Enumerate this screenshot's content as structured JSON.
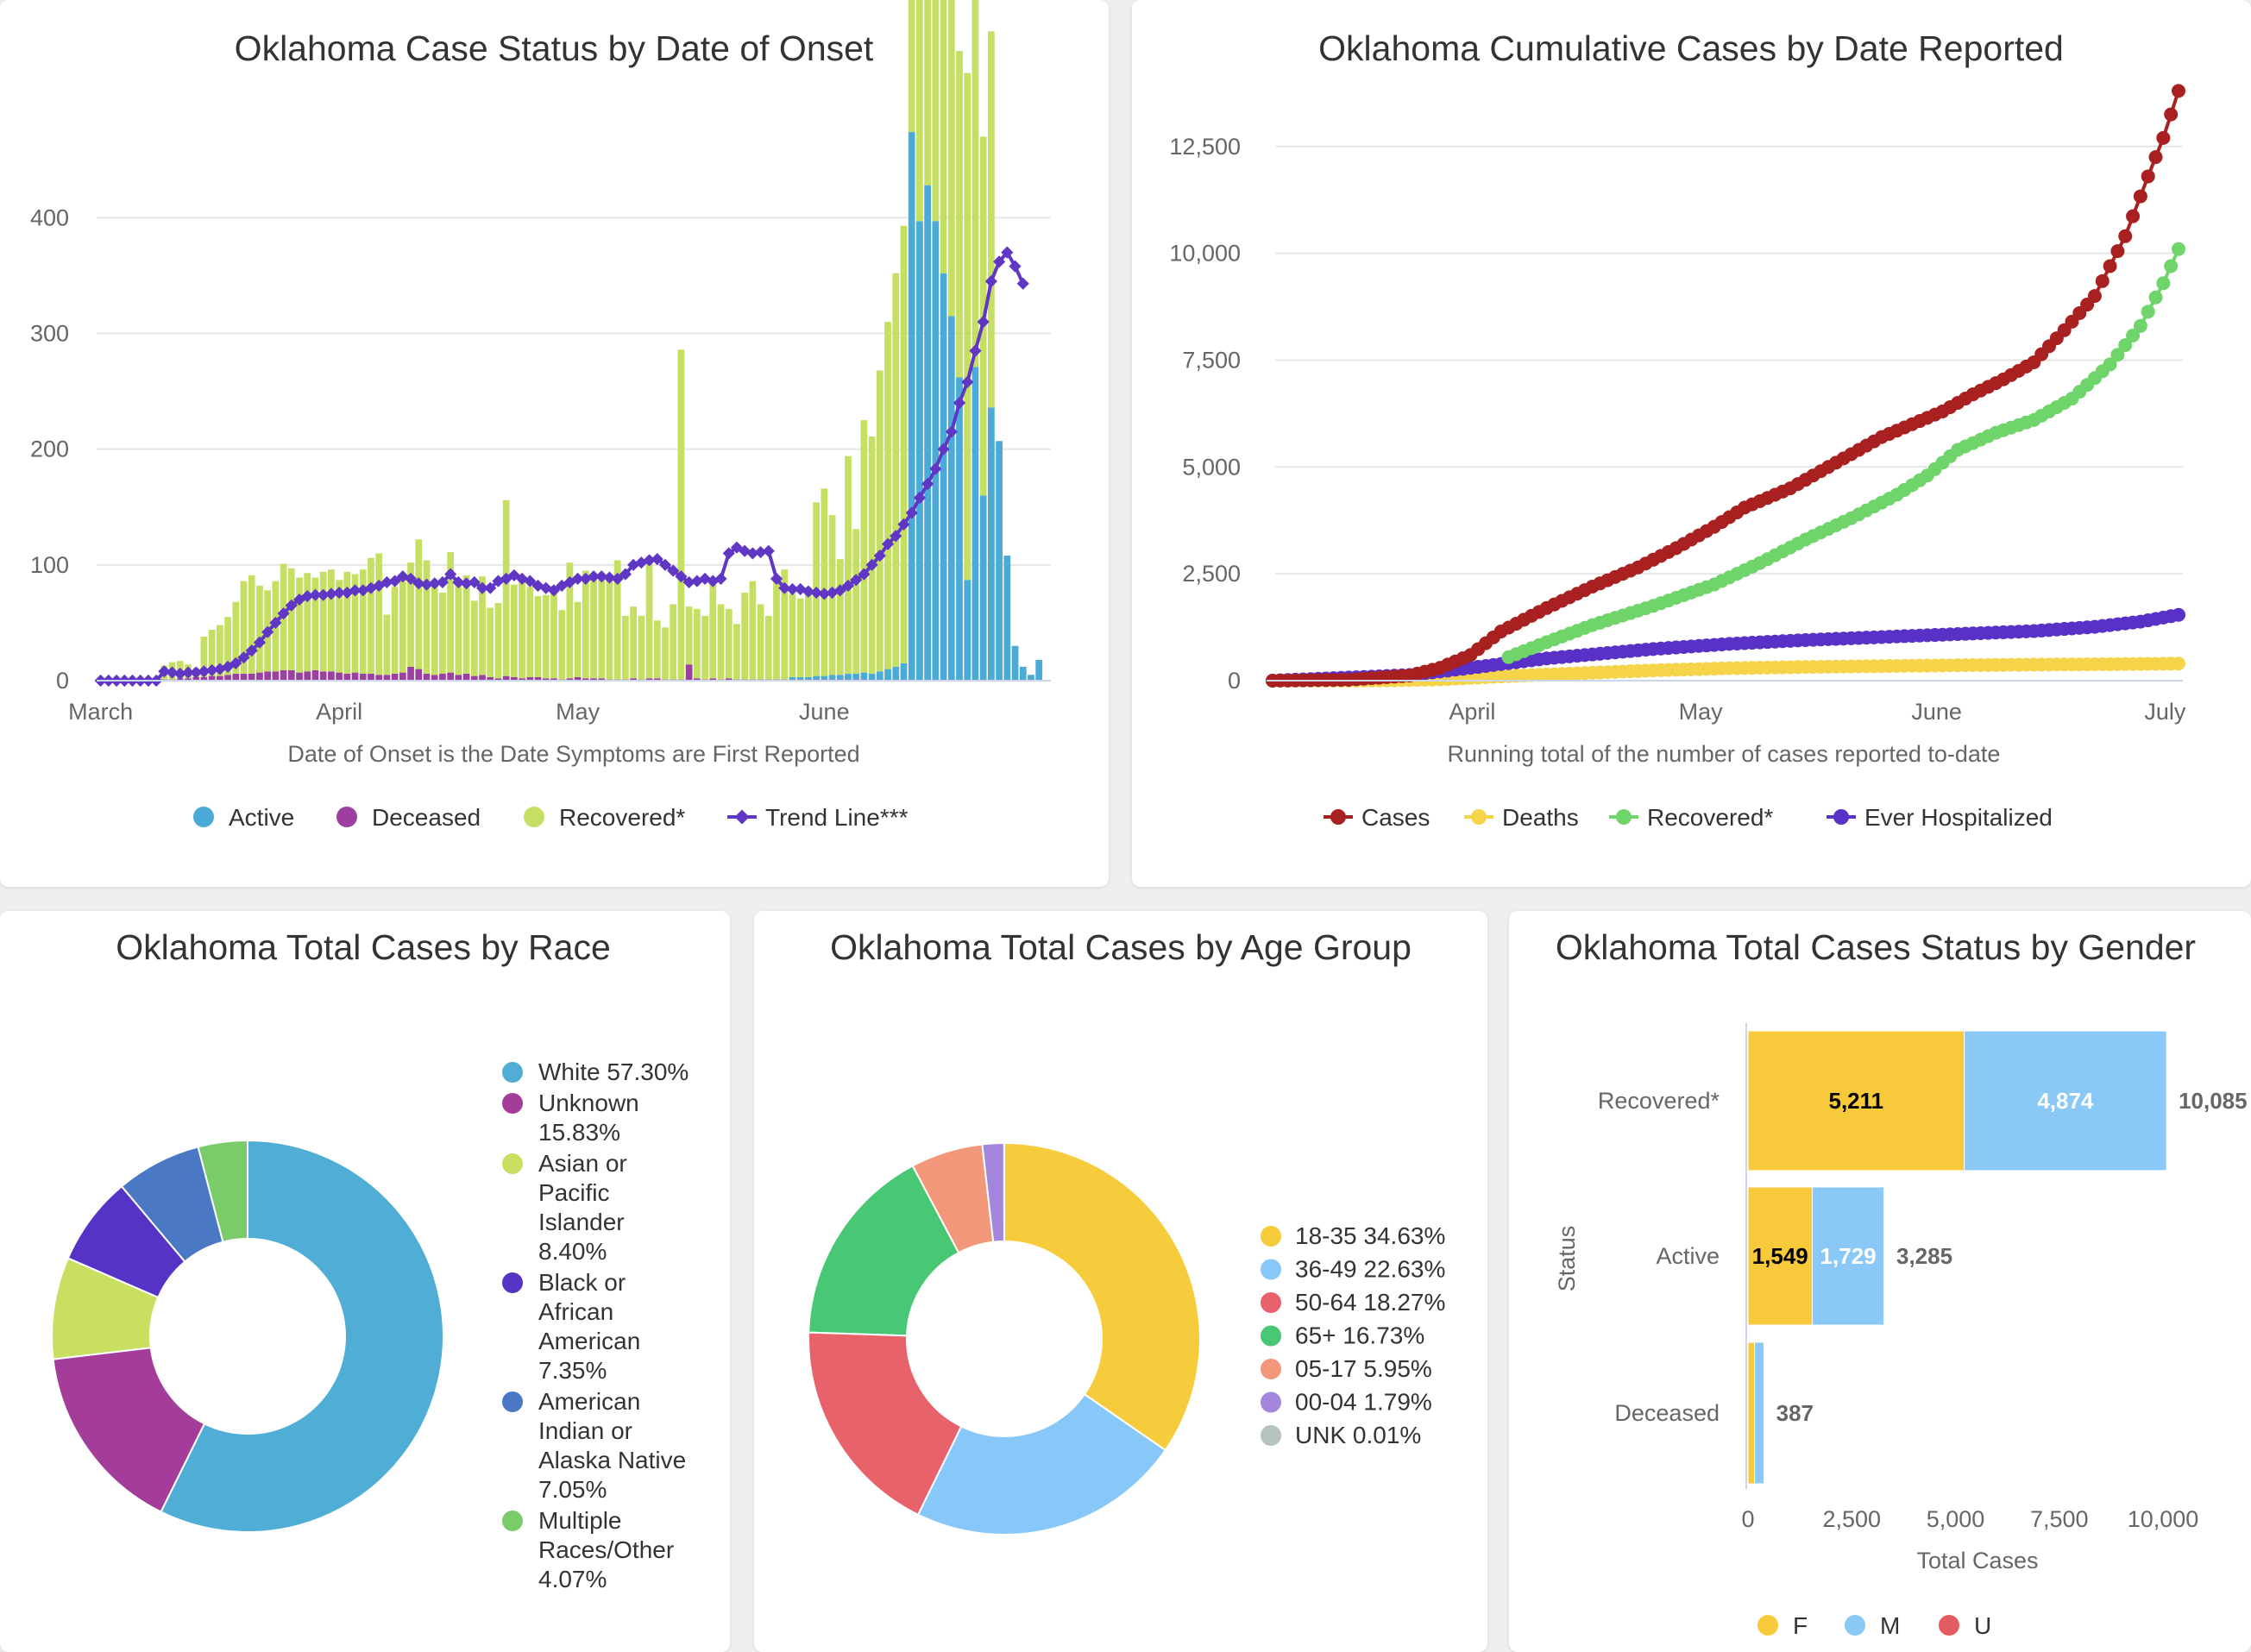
{
  "colors": {
    "active": "#4aabd8",
    "deceased": "#9c3fa0",
    "recovered": "#c5df63",
    "trend": "#6036c4",
    "cases": "#a82020",
    "deaths": "#f5d44a",
    "recovered2": "#6fd46a",
    "hospitalized": "#5a31c6",
    "gender_f": "#f8c93a",
    "gender_m": "#8ac8f7",
    "gender_u": "#e25c62"
  },
  "chart_data": [
    {
      "type": "bar",
      "title": "Oklahoma Case Status by Date of Onset",
      "xlabel": "Date of Onset is the Date Symptoms are First Reported",
      "ylabel": "",
      "ylim": [
        0,
        480
      ],
      "yticks": [
        0,
        100,
        200,
        300,
        400
      ],
      "xticks": [
        {
          "label": "March",
          "day": 0
        },
        {
          "label": "April",
          "day": 30
        },
        {
          "label": "May",
          "day": 60
        },
        {
          "label": "June",
          "day": 91
        }
      ],
      "legend_position": "bottom",
      "stacked": true,
      "categories_note": "days since first bar",
      "series": [
        {
          "name": "Active",
          "color_key": "active",
          "values": [
            0,
            0,
            0,
            0,
            0,
            0,
            0,
            0,
            0,
            0,
            0,
            0,
            0,
            0,
            0,
            0,
            0,
            0,
            0,
            0,
            0,
            0,
            0,
            0,
            0,
            0,
            0,
            0,
            0,
            0,
            0,
            0,
            0,
            0,
            0,
            0,
            0,
            0,
            0,
            0,
            0,
            0,
            0,
            0,
            0,
            0,
            0,
            0,
            0,
            0,
            0,
            0,
            0,
            0,
            0,
            0,
            0,
            0,
            0,
            0,
            0,
            0,
            0,
            0,
            0,
            0,
            0,
            0,
            0,
            0,
            0,
            0,
            0,
            0,
            0,
            0,
            0,
            0,
            0,
            0,
            0,
            0,
            0,
            0,
            0,
            0,
            0,
            2,
            2,
            2,
            3,
            3,
            4,
            4,
            5,
            5,
            6,
            6,
            8,
            10,
            12,
            15,
            474,
            397,
            428,
            397,
            352,
            315,
            262,
            87,
            271,
            160,
            236,
            207,
            108,
            30,
            12,
            5,
            18
          ]
        },
        {
          "name": "Deceased",
          "color_key": "deceased",
          "values": [
            0,
            0,
            0,
            0,
            0,
            0,
            0,
            0,
            1,
            1,
            2,
            2,
            3,
            3,
            4,
            4,
            5,
            6,
            6,
            6,
            7,
            8,
            8,
            9,
            9,
            7,
            8,
            9,
            8,
            8,
            7,
            6,
            7,
            6,
            6,
            5,
            5,
            6,
            7,
            12,
            10,
            6,
            5,
            6,
            7,
            5,
            6,
            4,
            5,
            3,
            2,
            4,
            3,
            2,
            3,
            3,
            2,
            2,
            1,
            2,
            3,
            2,
            2,
            2,
            1,
            1,
            1,
            2,
            1,
            2,
            2,
            1,
            1,
            1,
            14,
            2,
            1,
            2,
            1,
            2,
            1,
            1,
            1,
            1,
            1,
            1,
            1,
            1,
            1,
            1,
            1,
            1,
            1,
            1,
            1,
            1,
            1,
            0,
            0,
            0,
            0,
            0,
            0,
            0,
            0,
            0,
            0,
            0,
            0,
            0,
            0,
            0,
            0,
            0,
            0,
            0,
            0
          ]
        },
        {
          "name": "Recovered*",
          "color_key": "recovered",
          "values": [
            0,
            0,
            0,
            0,
            0,
            0,
            0,
            0,
            12,
            15,
            15,
            12,
            8,
            35,
            40,
            44,
            50,
            62,
            80,
            85,
            75,
            70,
            78,
            92,
            88,
            82,
            85,
            80,
            86,
            88,
            80,
            88,
            85,
            90,
            100,
            105,
            52,
            75,
            80,
            90,
            112,
            98,
            82,
            70,
            104,
            80,
            85,
            65,
            85,
            60,
            65,
            152,
            80,
            88,
            78,
            70,
            72,
            80,
            60,
            100,
            65,
            93,
            85,
            88,
            90,
            103,
            55,
            62,
            55,
            105,
            50,
            45,
            65,
            285,
            50,
            60,
            55,
            82,
            65,
            60,
            48,
            75,
            85,
            65,
            55,
            88,
            95,
            72,
            68,
            78,
            150,
            162,
            138,
            100,
            188,
            125,
            218,
            205,
            260,
            300,
            340,
            378,
            310,
            330,
            350,
            250,
            270,
            352,
            282,
            438,
            382,
            310,
            325,
            0,
            0,
            0,
            0
          ]
        },
        {
          "name": "Trend Line***",
          "color_key": "trend",
          "type": "line",
          "values": [
            0,
            0,
            0,
            0,
            0,
            0,
            0,
            0,
            8,
            7,
            6,
            7,
            7,
            8,
            9,
            10,
            12,
            15,
            20,
            26,
            33,
            42,
            50,
            58,
            65,
            70,
            73,
            74,
            74,
            75,
            76,
            76,
            78,
            78,
            80,
            82,
            85,
            86,
            90,
            88,
            84,
            83,
            84,
            85,
            92,
            85,
            84,
            85,
            80,
            80,
            86,
            88,
            91,
            88,
            86,
            82,
            80,
            78,
            82,
            85,
            88,
            88,
            90,
            90,
            89,
            88,
            92,
            100,
            102,
            104,
            105,
            100,
            95,
            90,
            85,
            86,
            88,
            86,
            88,
            110,
            115,
            112,
            110,
            111,
            112,
            88,
            80,
            79,
            79,
            77,
            76,
            75,
            76,
            78,
            82,
            87,
            92,
            100,
            108,
            118,
            125,
            135,
            145,
            158,
            170,
            183,
            200,
            215,
            240,
            258,
            285,
            310,
            345,
            362,
            370,
            358,
            343
          ]
        }
      ]
    },
    {
      "type": "line",
      "title": "Oklahoma Cumulative Cases by Date Reported",
      "xlabel": "Running total of the number of cases reported to-date",
      "ylabel": "",
      "ylim": [
        0,
        13000
      ],
      "yticks": [
        0,
        2500,
        5000,
        7500,
        10000,
        12500
      ],
      "ytick_labels": [
        "0",
        "2,500",
        "5,000",
        "7,500",
        "10,000",
        "12,500"
      ],
      "xticks": [
        {
          "label": "April",
          "day": 26
        },
        {
          "label": "May",
          "day": 56
        },
        {
          "label": "June",
          "day": 87
        },
        {
          "label": "July",
          "day": 117
        }
      ],
      "legend_position": "bottom",
      "series": [
        {
          "name": "Cases",
          "color_key": "cases",
          "points": [
            [
              0,
              0
            ],
            [
              10,
              20
            ],
            [
              18,
              120
            ],
            [
              22,
              300
            ],
            [
              26,
              600
            ],
            [
              30,
              1150
            ],
            [
              36,
              1700
            ],
            [
              42,
              2200
            ],
            [
              48,
              2650
            ],
            [
              53,
              3100
            ],
            [
              58,
              3600
            ],
            [
              62,
              4050
            ],
            [
              68,
              4500
            ],
            [
              72,
              4900
            ],
            [
              76,
              5300
            ],
            [
              80,
              5700
            ],
            [
              84,
              6000
            ],
            [
              88,
              6300
            ],
            [
              92,
              6700
            ],
            [
              96,
              7050
            ],
            [
              100,
              7450
            ],
            [
              104,
              8200
            ],
            [
              108,
              9000
            ],
            [
              112,
              10400
            ],
            [
              115,
              11800
            ],
            [
              117,
              12700
            ],
            [
              119,
              13800
            ]
          ]
        },
        {
          "name": "Deaths",
          "color_key": "deaths",
          "points": [
            [
              0,
              0
            ],
            [
              15,
              5
            ],
            [
              22,
              30
            ],
            [
              30,
              100
            ],
            [
              40,
              170
            ],
            [
              50,
              240
            ],
            [
              60,
              290
            ],
            [
              70,
              320
            ],
            [
              80,
              340
            ],
            [
              90,
              360
            ],
            [
              100,
              375
            ],
            [
              110,
              385
            ],
            [
              119,
              399
            ]
          ]
        },
        {
          "name": "Recovered*",
          "color_key": "recovered2",
          "points": [
            [
              31,
              550
            ],
            [
              36,
              900
            ],
            [
              42,
              1300
            ],
            [
              50,
              1750
            ],
            [
              58,
              2250
            ],
            [
              64,
              2750
            ],
            [
              70,
              3300
            ],
            [
              76,
              3800
            ],
            [
              82,
              4350
            ],
            [
              86,
              4800
            ],
            [
              90,
              5400
            ],
            [
              95,
              5800
            ],
            [
              100,
              6100
            ],
            [
              105,
              6600
            ],
            [
              110,
              7400
            ],
            [
              114,
              8300
            ],
            [
              117,
              9300
            ],
            [
              119,
              10100
            ]
          ]
        },
        {
          "name": "Ever Hospitalized",
          "color_key": "hospitalized",
          "points": [
            [
              0,
              0
            ],
            [
              18,
              130
            ],
            [
              26,
              300
            ],
            [
              36,
              520
            ],
            [
              50,
              740
            ],
            [
              60,
              860
            ],
            [
              70,
              950
            ],
            [
              80,
              1020
            ],
            [
              90,
              1090
            ],
            [
              100,
              1160
            ],
            [
              108,
              1260
            ],
            [
              114,
              1380
            ],
            [
              119,
              1540
            ]
          ]
        }
      ]
    },
    {
      "type": "pie",
      "title": "Oklahoma Total Cases by Race",
      "legend_position": "right",
      "series": [
        {
          "name": "White",
          "value": 57.3,
          "label": "White 57.30%",
          "color": "#50aed6"
        },
        {
          "name": "Unknown",
          "value": 15.83,
          "label": "Unknown 15.83%",
          "color": "#a43d99"
        },
        {
          "name": "Asian or Pacific Islander",
          "value": 8.4,
          "label": "Asian or Pacific Islander 8.40%",
          "color": "#c8df62"
        },
        {
          "name": "Black or African American",
          "value": 7.35,
          "label": "Black or African American 7.35%",
          "color": "#5533c4"
        },
        {
          "name": "American Indian or Alaska Native",
          "value": 7.05,
          "label": "American Indian or Alaska Native 7.05%",
          "color": "#4a78c4"
        },
        {
          "name": "Multiple Races/Other",
          "value": 4.07,
          "label": "Multiple Races/Other 4.07%",
          "color": "#7acc68"
        }
      ]
    },
    {
      "type": "pie",
      "title": "Oklahoma Total Cases by Age Group",
      "legend_position": "right",
      "series": [
        {
          "name": "18-35",
          "value": 34.63,
          "label": "18-35 34.63%",
          "color": "#f7cc3c"
        },
        {
          "name": "36-49",
          "value": 22.63,
          "label": "36-49 22.63%",
          "color": "#88c8f8"
        },
        {
          "name": "50-64",
          "value": 18.27,
          "label": "50-64 18.27%",
          "color": "#e8626c"
        },
        {
          "name": "65+",
          "value": 16.73,
          "label": "65+ 16.73%",
          "color": "#48c774"
        },
        {
          "name": "05-17",
          "value": 5.95,
          "label": "05-17 5.95%",
          "color": "#f3977a"
        },
        {
          "name": "00-04",
          "value": 1.79,
          "label": "00-04 1.79%",
          "color": "#a487dd"
        },
        {
          "name": "UNK",
          "value": 0.01,
          "label": "UNK 0.01%",
          "color": "#b6c4be"
        }
      ]
    },
    {
      "type": "bar",
      "orientation": "horizontal",
      "stacked": true,
      "title": "Oklahoma Total Cases Status by Gender",
      "xlabel": "Total Cases",
      "ylabel": "Status",
      "xlim": [
        0,
        10000
      ],
      "xticks": [
        0,
        2500,
        5000,
        7500,
        10000
      ],
      "xtick_labels": [
        "0",
        "2,500",
        "5,000",
        "7,500",
        "10,000"
      ],
      "categories": [
        "Recovered*",
        "Active",
        "Deceased"
      ],
      "totals": [
        10085,
        3285,
        387
      ],
      "total_labels": [
        "10,085",
        "3,285",
        "387"
      ],
      "legend_position": "bottom",
      "series": [
        {
          "name": "F",
          "color_key": "gender_f",
          "values": [
            5211,
            1549,
            158
          ],
          "labels": [
            "5,211",
            "1,549",
            ""
          ]
        },
        {
          "name": "M",
          "color_key": "gender_m",
          "values": [
            4874,
            1729,
            229
          ],
          "labels": [
            "4,874",
            "1,729",
            ""
          ]
        },
        {
          "name": "U",
          "color_key": "gender_u",
          "values": [
            0,
            7,
            0
          ],
          "labels": [
            "",
            "",
            ""
          ]
        }
      ]
    }
  ]
}
